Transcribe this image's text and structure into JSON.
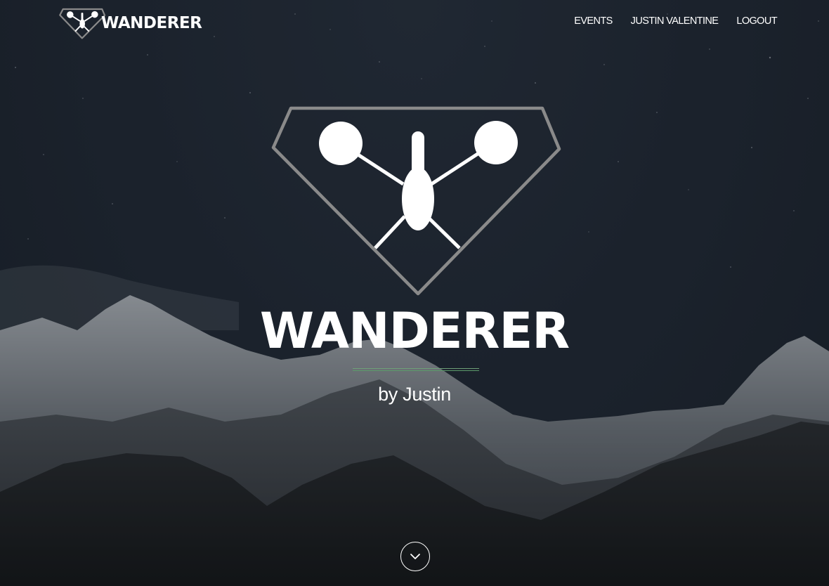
{
  "brand": {
    "name": "WANDERER",
    "logo_icon": "wanderer-logo-icon"
  },
  "nav": {
    "items": [
      {
        "label": "EVENTS"
      },
      {
        "label": "JUSTIN VALENTINE"
      },
      {
        "label": "LOGOUT"
      }
    ]
  },
  "hero": {
    "logo_icon": "wanderer-emblem-icon",
    "title": "WANDERER",
    "subtitle": "by Justin",
    "scroll_icon": "chevron-down-icon"
  },
  "colors": {
    "background": "#1c2430",
    "text": "#ffffff",
    "emblem_outline": "#8a8a8a",
    "divider": "#5b9a69"
  }
}
